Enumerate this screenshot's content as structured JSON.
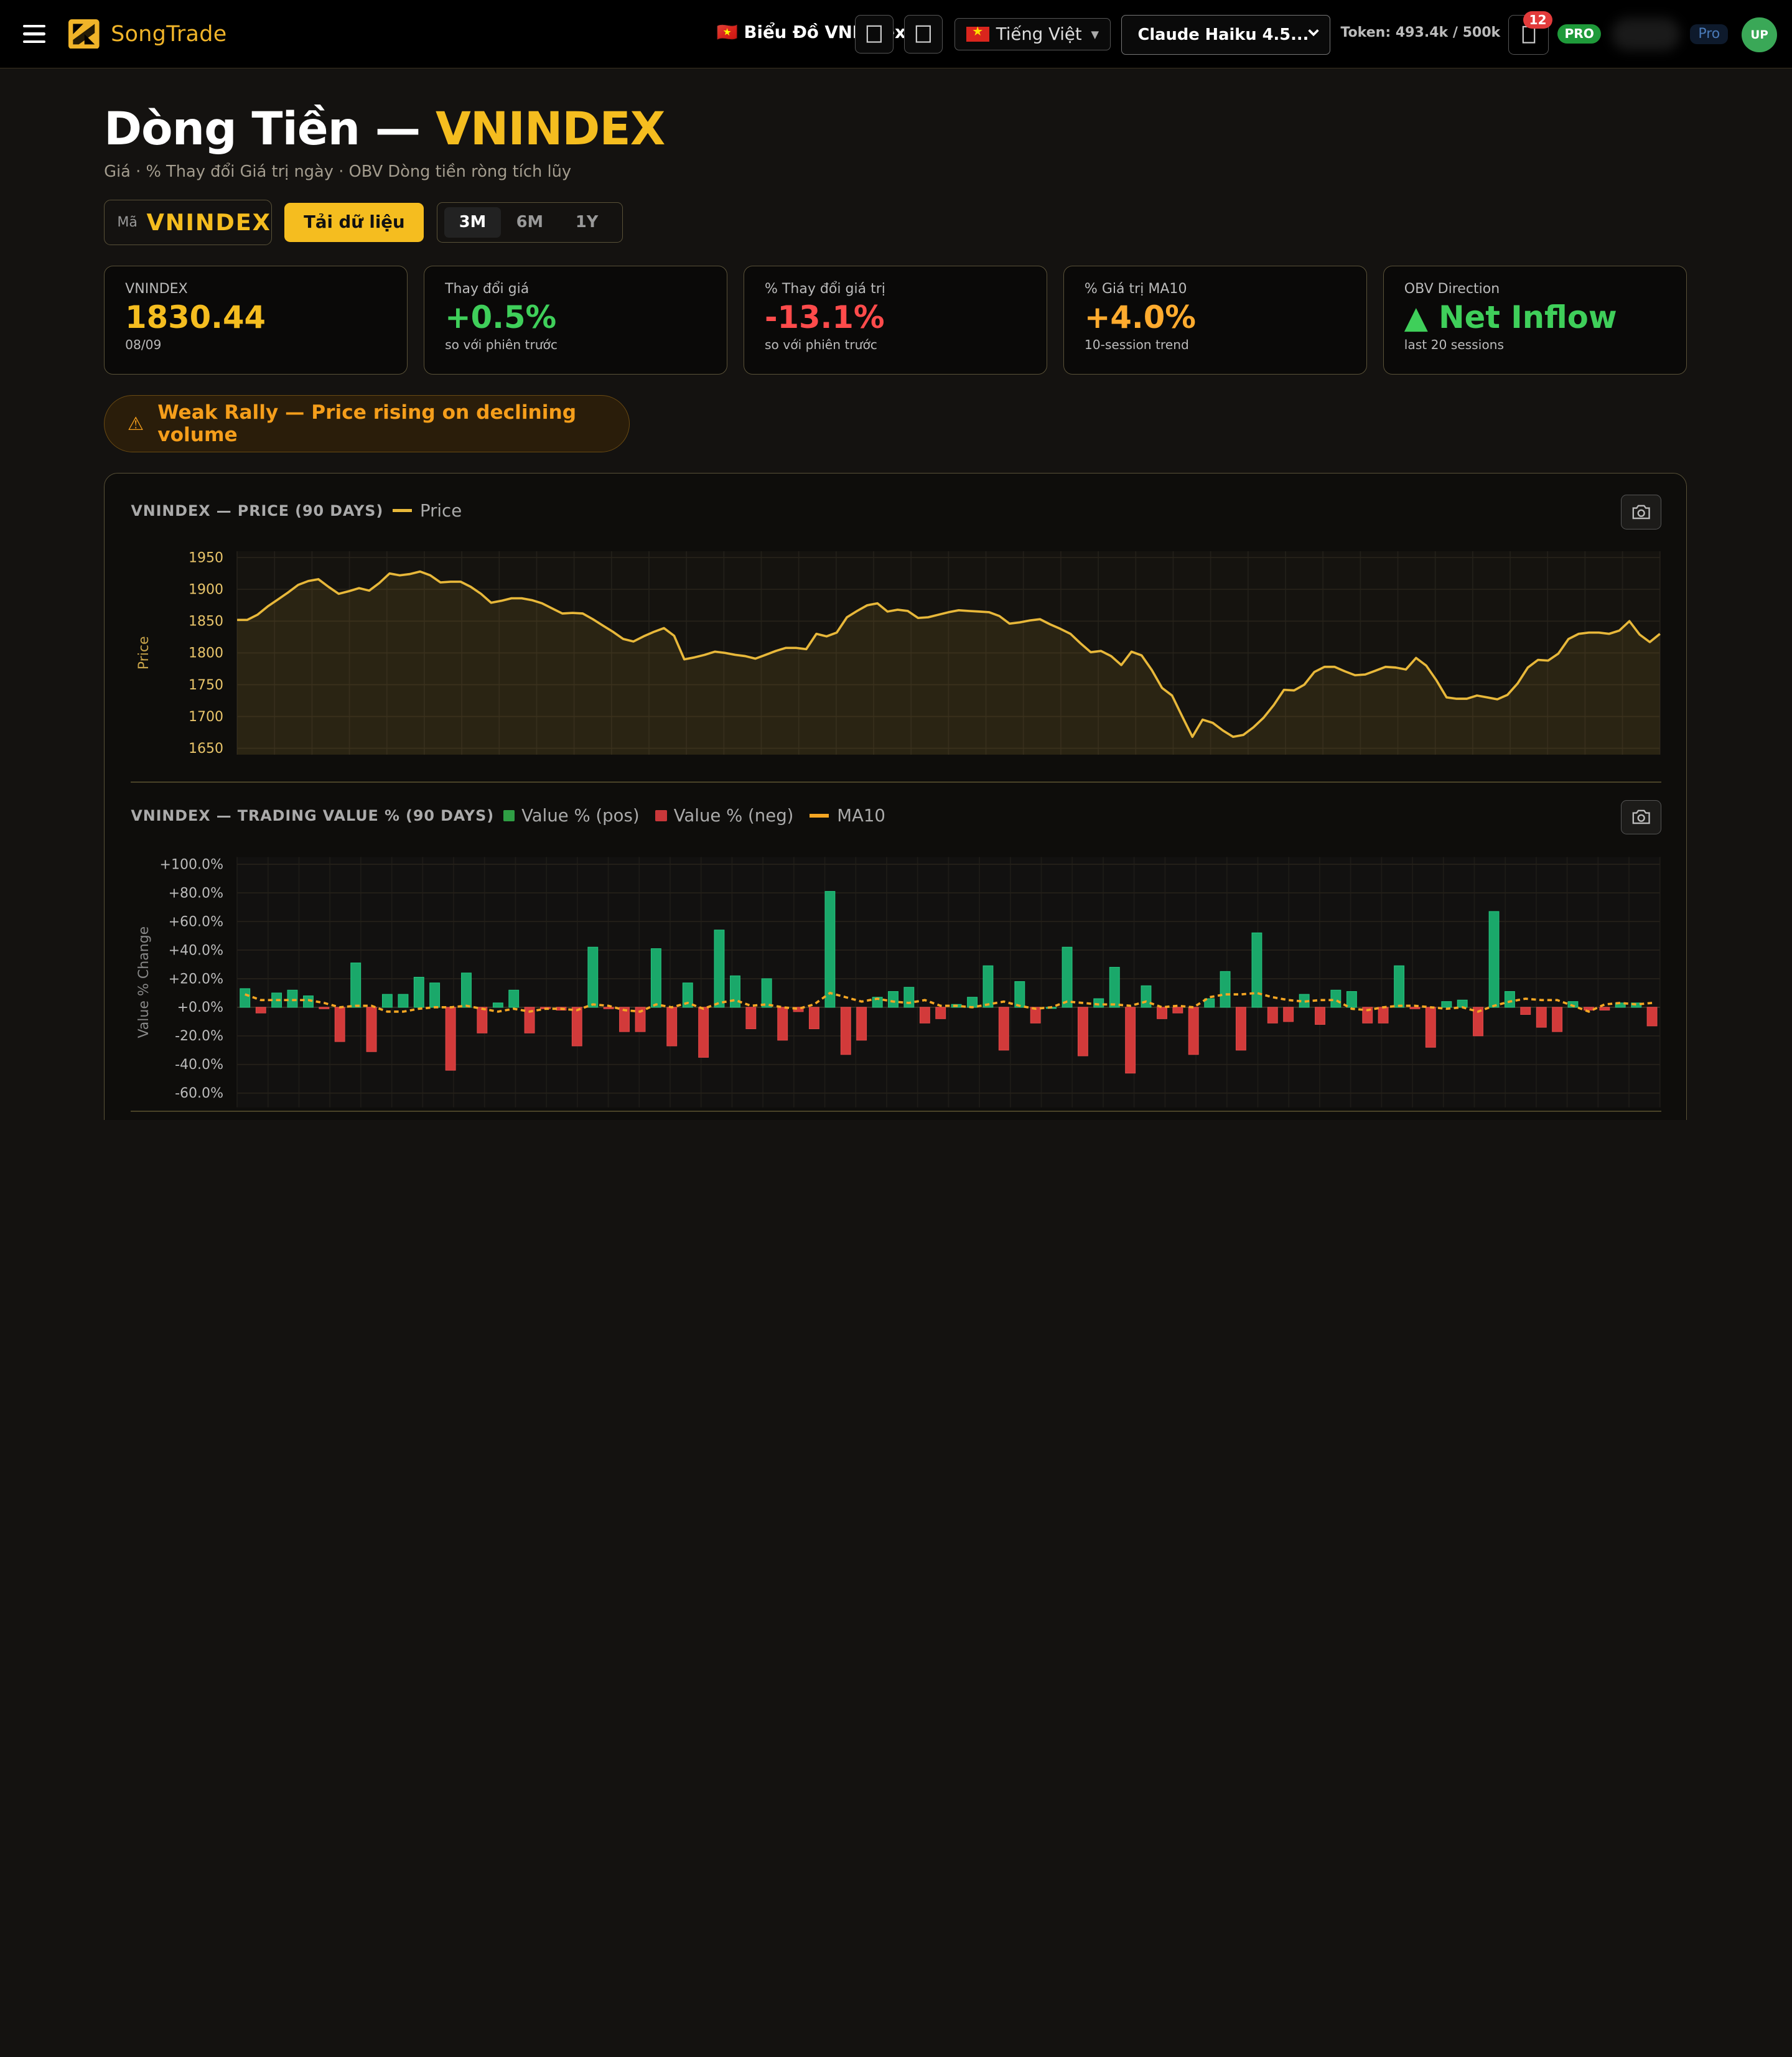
{
  "header": {
    "brand": "SongTrade",
    "nav_chart": "🇻🇳 Biểu Đồ VNIndex",
    "language": "Tiếng Việt",
    "model": "Claude Haiku 4.5...",
    "token": "Token: 493.4k / 500k",
    "notifications": "12",
    "plan_badge": "PRO",
    "plan_tag": "Pro",
    "avatar": "UP"
  },
  "page": {
    "title_prefix": "Dòng Tiền — ",
    "title_symbol": "VNINDEX",
    "subtitle": "Giá · % Thay đổi Giá trị ngày · OBV Dòng tiền ròng tích lũy"
  },
  "controls": {
    "symbol_label": "Mã",
    "symbol_value": "VNINDEX",
    "load_button": "Tải dữ liệu",
    "ranges": [
      "3M",
      "6M",
      "1Y"
    ],
    "active_range": "3M"
  },
  "cards": [
    {
      "label": "VNINDEX",
      "value": "1830.44",
      "sub": "08/09",
      "color": "#f5bd1f"
    },
    {
      "label": "Thay đổi giá",
      "value": "+0.5%",
      "sub": "so với phiên trước",
      "color": "#3fcf5a"
    },
    {
      "label": "% Thay đổi giá trị",
      "value": "-13.1%",
      "sub": "so với phiên trước",
      "color": "#ff4b4b"
    },
    {
      "label": "% Giá trị MA10",
      "value": "+4.0%",
      "sub": "10-session trend",
      "color": "#ffab2e"
    },
    {
      "label": "OBV Direction",
      "value": "▲ Net Inflow",
      "sub": "last 20 sessions",
      "color": "#3fcf5a"
    }
  ],
  "alert": {
    "icon": "⚠",
    "text": "Weak Rally — Price rising on declining volume"
  },
  "chart_data": [
    {
      "type": "line",
      "title": "VNINDEX — PRICE (90 DAYS)",
      "legend": [
        "Price"
      ],
      "ylabel": "Price",
      "ylim": [
        1640,
        1960
      ],
      "yticks": [
        1950,
        1900,
        1850,
        1800,
        1750,
        1700,
        1650
      ],
      "color": "#e8b83a",
      "series": [
        {
          "name": "Price",
          "values": [
            1852,
            1852,
            1860,
            1873,
            1884,
            1895,
            1907,
            1913,
            1916,
            1904,
            1893,
            1897,
            1902,
            1898,
            1910,
            1925,
            1922,
            1924,
            1928,
            1922,
            1911,
            1912,
            1912,
            1904,
            1893,
            1879,
            1882,
            1886,
            1886,
            1883,
            1878,
            1870,
            1862,
            1863,
            1862,
            1853,
            1843,
            1833,
            1822,
            1818,
            1826,
            1833,
            1839,
            1827,
            1790,
            1793,
            1797,
            1802,
            1800,
            1797,
            1795,
            1791,
            1797,
            1803,
            1808,
            1808,
            1806,
            1830,
            1826,
            1832,
            1856,
            1866,
            1875,
            1878,
            1865,
            1868,
            1866,
            1855,
            1856,
            1860,
            1864,
            1867,
            1866,
            1865,
            1864,
            1858,
            1846,
            1848,
            1851,
            1853,
            1845,
            1838,
            1830,
            1815,
            1801,
            1803,
            1795,
            1781,
            1802,
            1796,
            1773,
            1745,
            1733,
            1700,
            1668,
            1695,
            1690,
            1678,
            1668,
            1671,
            1683,
            1698,
            1718,
            1742,
            1741,
            1750,
            1770,
            1778,
            1778,
            1771,
            1765,
            1766,
            1772,
            1778,
            1777,
            1774,
            1792,
            1780,
            1757,
            1730,
            1728,
            1728,
            1733,
            1730,
            1727,
            1734,
            1752,
            1777,
            1789,
            1788,
            1799,
            1822,
            1830,
            1832,
            1832,
            1830,
            1835,
            1850,
            1829,
            1817,
            1830
          ]
        }
      ]
    },
    {
      "type": "bar",
      "title": "VNINDEX — TRADING VALUE % (90 DAYS)",
      "legend": [
        "Value % (pos)",
        "Value % (neg)",
        "MA10"
      ],
      "ylabel": "Value % Change",
      "ylim": [
        -70,
        105
      ],
      "yticks": [
        "+100.0%",
        "+80.0%",
        "+60.0%",
        "+40.0%",
        "+20.0%",
        "+0.0%",
        "-20.0%",
        "-40.0%",
        "-60.0%"
      ],
      "ytick_values": [
        100,
        80,
        60,
        40,
        20,
        0,
        -20,
        -40,
        -60
      ],
      "pos_color": "#1aa86a",
      "neg_color": "#d23a3a",
      "ma_color": "#f5a623",
      "values": [
        13,
        -4,
        10,
        12,
        8,
        -1,
        -24,
        31,
        -31,
        9,
        9,
        21,
        17,
        -44,
        24,
        -18,
        3,
        12,
        -18,
        -1,
        -2,
        -27,
        42,
        -1,
        -17,
        -17,
        41,
        -27,
        17,
        -35,
        54,
        22,
        -15,
        20,
        -23,
        -3,
        -15,
        81,
        -33,
        -23,
        7,
        11,
        14,
        -11,
        -8,
        2,
        7,
        29,
        -30,
        18,
        -11,
        0,
        42,
        -34,
        6,
        28,
        -46,
        15,
        -8,
        -4,
        -33,
        6,
        25,
        -30,
        52,
        -11,
        -10,
        9,
        -12,
        12,
        11,
        -11,
        -11,
        29,
        -1,
        -28,
        4,
        5,
        -20,
        67,
        11,
        -5,
        -14,
        -17,
        4,
        -2,
        -2,
        3,
        3,
        -13
      ],
      "ma10": [
        9,
        5,
        5,
        5,
        5,
        3,
        0,
        1,
        1,
        -3,
        -3,
        -1,
        0,
        0,
        1,
        -1,
        -3,
        -1,
        -3,
        -1,
        -1,
        -2,
        2,
        1,
        -2,
        -3,
        2,
        0,
        3,
        -1,
        3,
        5,
        1,
        2,
        0,
        -1,
        2,
        10,
        7,
        4,
        6,
        4,
        3,
        5,
        1,
        1,
        0,
        2,
        4,
        1,
        -1,
        0,
        4,
        3,
        2,
        2,
        1,
        4,
        0,
        1,
        0,
        7,
        9,
        9,
        10,
        7,
        5,
        4,
        5,
        5,
        -1,
        -2,
        0,
        1,
        1,
        0,
        -1,
        0,
        -3,
        1,
        4,
        6,
        5,
        5,
        1,
        -3,
        2,
        3,
        2,
        3
      ]
    }
  ]
}
